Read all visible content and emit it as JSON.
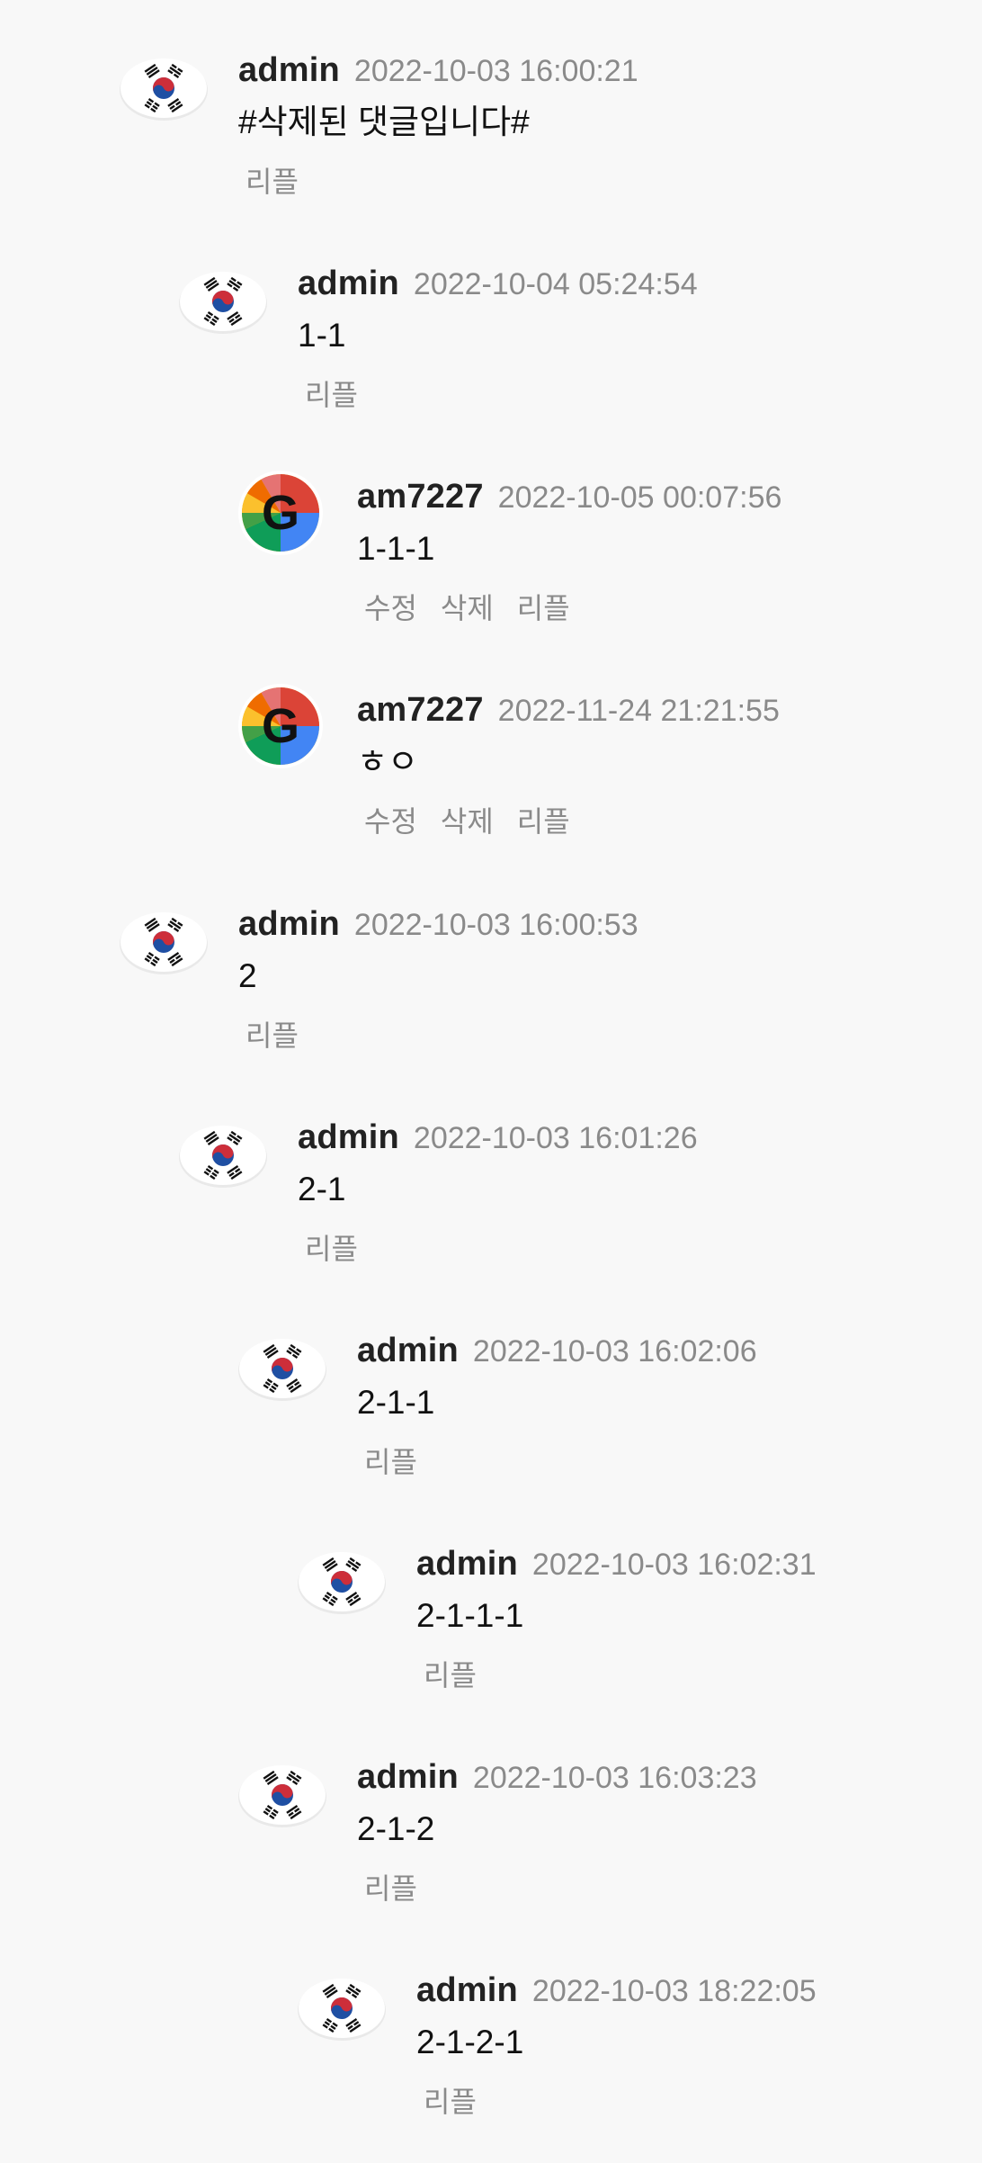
{
  "comments": [
    {
      "author": "admin",
      "time": "2022-10-03 16:00:21",
      "text": "#삭제된 댓글입니다#",
      "actions": [
        "리플"
      ],
      "avatar": "korea-flag-icon"
    },
    {
      "author": "admin",
      "time": "2022-10-04 05:24:54",
      "text": "1-1",
      "actions": [
        "리플"
      ],
      "avatar": "korea-flag-icon"
    },
    {
      "author": "am7227",
      "time": "2022-10-05 00:07:56",
      "text": "1-1-1",
      "actions": [
        "수정",
        "삭제",
        "리플"
      ],
      "avatar": "google-icon"
    },
    {
      "author": "am7227",
      "time": "2022-11-24 21:21:55",
      "text": "ㅎㅇ",
      "actions": [
        "수정",
        "삭제",
        "리플"
      ],
      "avatar": "google-icon"
    },
    {
      "author": "admin",
      "time": "2022-10-03 16:00:53",
      "text": "2",
      "actions": [
        "리플"
      ],
      "avatar": "korea-flag-icon"
    },
    {
      "author": "admin",
      "time": "2022-10-03 16:01:26",
      "text": "2-1",
      "actions": [
        "리플"
      ],
      "avatar": "korea-flag-icon"
    },
    {
      "author": "admin",
      "time": "2022-10-03 16:02:06",
      "text": "2-1-1",
      "actions": [
        "리플"
      ],
      "avatar": "korea-flag-icon"
    },
    {
      "author": "admin",
      "time": "2022-10-03 16:02:31",
      "text": "2-1-1-1",
      "actions": [
        "리플"
      ],
      "avatar": "korea-flag-icon"
    },
    {
      "author": "admin",
      "time": "2022-10-03 16:03:23",
      "text": "2-1-2",
      "actions": [
        "리플"
      ],
      "avatar": "korea-flag-icon"
    },
    {
      "author": "admin",
      "time": "2022-10-03 18:22:05",
      "text": "2-1-2-1",
      "actions": [
        "리플"
      ],
      "avatar": "korea-flag-icon"
    }
  ]
}
